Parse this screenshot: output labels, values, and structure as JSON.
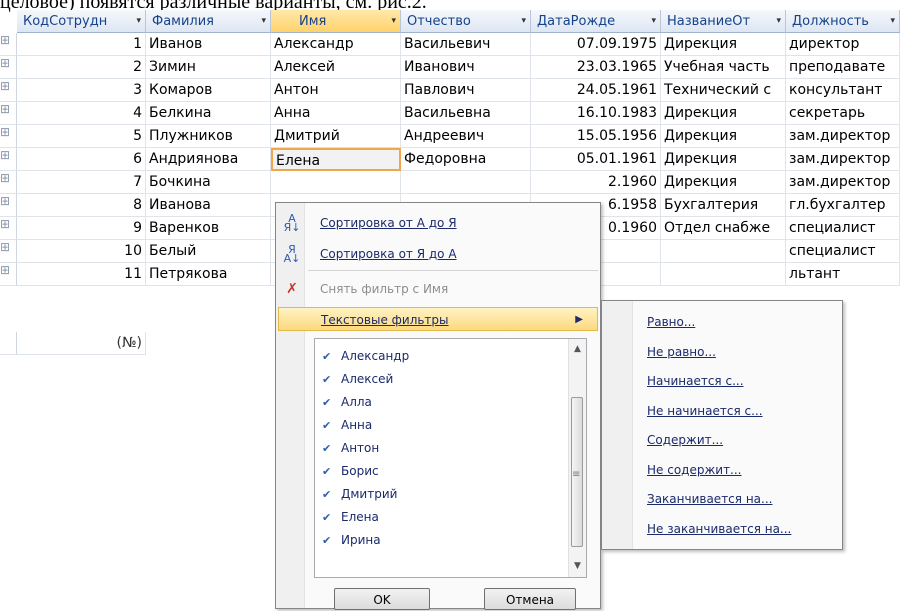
{
  "doc_text": "целовое) появятся различные варианты, см. рис.2.",
  "columns": [
    {
      "label": "КодСотрудн",
      "dd": "▾"
    },
    {
      "label": "Фамилия",
      "dd": "▾"
    },
    {
      "label": "Имя",
      "dd": "▾"
    },
    {
      "label": "Отчество",
      "dd": "▾"
    },
    {
      "label": "ДатаРожде",
      "dd": "▾"
    },
    {
      "label": "НазваниеОт",
      "dd": "▾"
    },
    {
      "label": "Должность",
      "dd": "▾"
    }
  ],
  "rows": [
    {
      "id": "1",
      "last": "Иванов",
      "first": "Александр",
      "middle": "Васильевич",
      "birth": "07.09.1975",
      "dept": "Дирекция",
      "pos": "директор"
    },
    {
      "id": "2",
      "last": "Зимин",
      "first": "Алексей",
      "middle": "Иванович",
      "birth": "23.03.1965",
      "dept": "Учебная часть",
      "pos": "преподавате"
    },
    {
      "id": "3",
      "last": "Комаров",
      "first": "Антон",
      "middle": "Павлович",
      "birth": "24.05.1961",
      "dept": "Технический с",
      "pos": "консультант"
    },
    {
      "id": "4",
      "last": "Белкина",
      "first": "Анна",
      "middle": "Васильевна",
      "birth": "16.10.1983",
      "dept": "Дирекция",
      "pos": "секретарь"
    },
    {
      "id": "5",
      "last": "Плужников",
      "first": "Дмитрий",
      "middle": "Андреевич",
      "birth": "15.05.1956",
      "dept": "Дирекция",
      "pos": "зам.директор"
    },
    {
      "id": "6",
      "last": "Андриянова",
      "first": "Елена",
      "middle": "Федоровна",
      "birth": "05.01.1961",
      "dept": "Дирекция",
      "pos": "зам.директор"
    },
    {
      "id": "7",
      "last": "Бочкина",
      "first": "",
      "middle": "",
      "birth": "2.1960",
      "dept": "Дирекция",
      "pos": "зам.директор"
    },
    {
      "id": "8",
      "last": "Иванова",
      "first": "",
      "middle": "",
      "birth": "6.1958",
      "dept": "Бухгалтерия",
      "pos": "гл.бухгалтер"
    },
    {
      "id": "9",
      "last": "Варенков",
      "first": "",
      "middle": "",
      "birth": "0.1960",
      "dept": "Отдел снабже",
      "pos": "специалист"
    },
    {
      "id": "10",
      "last": "Белый",
      "first": "",
      "middle": "",
      "birth": "",
      "dept": "",
      "pos": "специалист"
    },
    {
      "id": "11",
      "last": "Петрякова",
      "first": "",
      "middle": "",
      "birth": "",
      "dept": "",
      "pos": "льтант"
    }
  ],
  "new_row": "(№)",
  "row_marker": "⊞",
  "menu": {
    "sort_az": "Сортировка от А до Я",
    "sort_za": "Сортировка от Я до А",
    "clear_filter": "Снять фильтр с Имя",
    "text_filters": "Текстовые фильтры",
    "sort_az_icon": "А\nЯ↓",
    "sort_za_icon": "Я\nА↓",
    "clear_icon": "✗"
  },
  "values_list": [
    "Александр",
    "Алексей",
    "Алла",
    "Анна",
    "Антон",
    "Борис",
    "Дмитрий",
    "Елена",
    "Ирина"
  ],
  "checked_mark": "✔",
  "ok_label": "OK",
  "cancel_label": "Отмена",
  "submenu": [
    "Равно...",
    "Не равно...",
    "Начинается с...",
    "Не начинается с...",
    "Содержит...",
    "Не содержит...",
    "Заканчивается на...",
    "Не заканчивается на..."
  ]
}
